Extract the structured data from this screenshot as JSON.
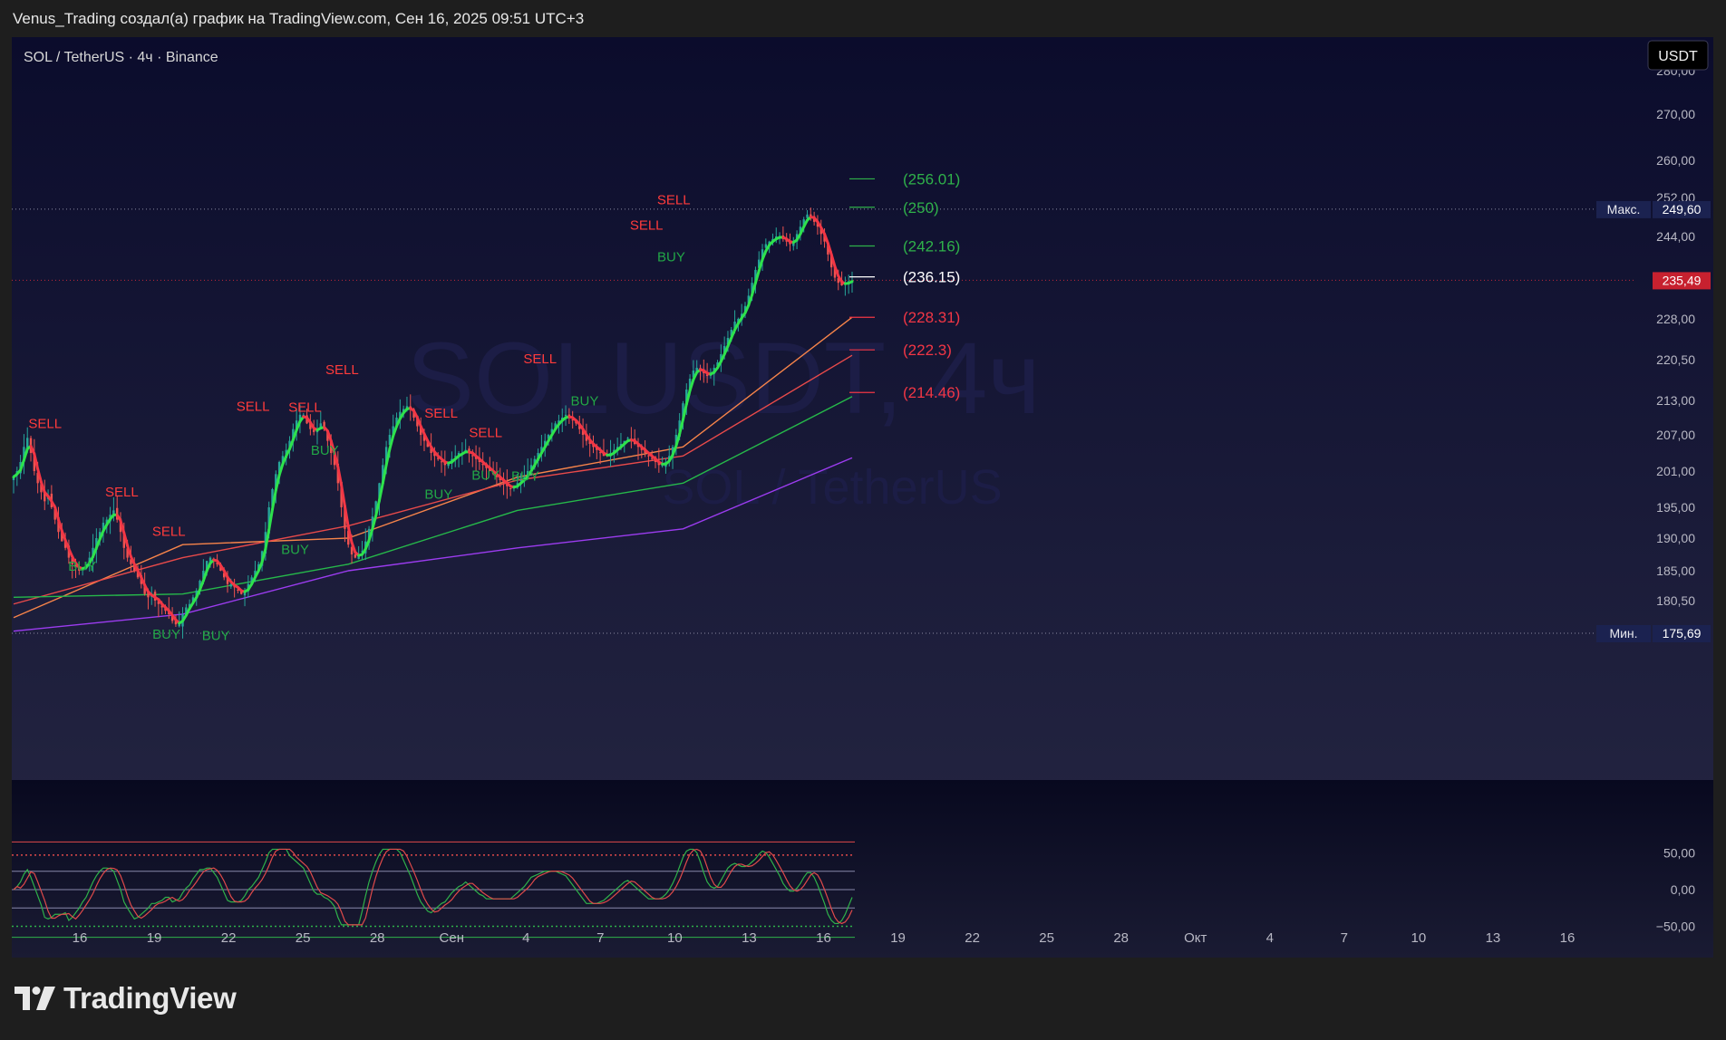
{
  "header": {
    "attribution": "Venus_Trading создал(а) график на TradingView.com, Сен 16, 2025 09:51 UTC+3"
  },
  "chart": {
    "symbol_line": "SOL / TetherUS · 4ч · Binance",
    "currency_button": "USDT",
    "watermark_big": "SOLUSDT, 4ч",
    "watermark_small": "SOL / TetherUS",
    "max_label": "Макс.",
    "max_value": "249,60",
    "min_label": "Мин.",
    "min_value": "175,69",
    "last_price": "235,49",
    "colors": {
      "bg_top": "#0b0c2c",
      "bg_bottom": "#272844",
      "bull": "#26a69a",
      "bear": "#ef5350",
      "trail_up": "#2ee24c",
      "trail_down": "#f23645",
      "ma_orange": "#f7844a",
      "ma_red": "#e84a4a",
      "ma_green": "#26b84a",
      "ma_purple": "#9c3cf0"
    }
  },
  "footer": {
    "brand": "TradingView"
  },
  "chart_data": {
    "type": "candlestick",
    "title": "SOLUSDT, 4ч",
    "y_ticks": [
      "280,00",
      "270,00",
      "260,00",
      "252,00",
      "244,00",
      "228,00",
      "220,50",
      "213,00",
      "207,00",
      "201,00",
      "195,00",
      "190,00",
      "185,00",
      "180,50"
    ],
    "x_ticks": [
      "16",
      "19",
      "22",
      "25",
      "28",
      "Сен",
      "4",
      "7",
      "10",
      "13",
      "16",
      "19",
      "22",
      "25",
      "28",
      "Окт",
      "4",
      "7",
      "10",
      "13",
      "16"
    ],
    "price_range": [
      175.69,
      249.6
    ],
    "levels": [
      {
        "label": "(256.01)",
        "value": 256.01,
        "color": "#2fb14a"
      },
      {
        "label": "(250)",
        "value": 250,
        "color": "#2fb14a"
      },
      {
        "label": "(242.16)",
        "value": 242.16,
        "color": "#2fb14a"
      },
      {
        "label": "(236.15)",
        "value": 236.15,
        "color": "#ffffff"
      },
      {
        "label": "(228.31)",
        "value": 228.31,
        "color": "#f23645"
      },
      {
        "label": "(222.3)",
        "value": 222.3,
        "color": "#f23645"
      },
      {
        "label": "(214.46)",
        "value": 214.46,
        "color": "#f23645"
      }
    ],
    "signals": [
      {
        "text": "SELL",
        "day": 0.8,
        "price": 208.2
      },
      {
        "text": "SELL",
        "day": 3.9,
        "price": 196.8
      },
      {
        "text": "SELL",
        "day": 5.8,
        "price": 190.4
      },
      {
        "text": "SELL",
        "day": 9.2,
        "price": 211.2
      },
      {
        "text": "SELL",
        "day": 11.3,
        "price": 211.0
      },
      {
        "text": "SELL",
        "day": 12.8,
        "price": 217.8
      },
      {
        "text": "SELL",
        "day": 16.8,
        "price": 210.0
      },
      {
        "text": "SELL",
        "day": 18.6,
        "price": 206.6
      },
      {
        "text": "SELL",
        "day": 20.8,
        "price": 219.8
      },
      {
        "text": "SELL",
        "day": 25.1,
        "price": 245.4
      },
      {
        "text": "SELL",
        "day": 26.2,
        "price": 250.6
      },
      {
        "text": "BUY",
        "day": 2.3,
        "price": 185.0
      },
      {
        "text": "BUY",
        "day": 5.7,
        "price": 174.9
      },
      {
        "text": "BUY",
        "day": 7.7,
        "price": 174.7
      },
      {
        "text": "BUY",
        "day": 10.9,
        "price": 187.6
      },
      {
        "text": "BUY",
        "day": 12.1,
        "price": 203.7
      },
      {
        "text": "BUY",
        "day": 16.7,
        "price": 196.4
      },
      {
        "text": "BUY",
        "day": 18.6,
        "price": 199.6
      },
      {
        "text": "BUY",
        "day": 20.2,
        "price": 199.4
      },
      {
        "text": "BUY",
        "day": 22.6,
        "price": 212.1
      },
      {
        "text": "BUY",
        "day": 26.1,
        "price": 239.2
      }
    ],
    "close_series": {
      "start": "Авг 13",
      "interval": "4ч",
      "values": [
        200.0,
        201.0,
        202.5,
        205.0,
        206.5,
        204.0,
        201.0,
        199.0,
        197.5,
        196.0,
        197.0,
        195.0,
        193.0,
        191.0,
        189.5,
        188.5,
        187.0,
        186.0,
        185.5,
        185.0,
        185.5,
        186.0,
        187.0,
        188.5,
        190.0,
        191.0,
        192.5,
        193.0,
        193.8,
        194.5,
        193.0,
        191.0,
        188.5,
        187.0,
        186.0,
        185.0,
        184.0,
        183.0,
        181.5,
        181.0,
        181.5,
        180.5,
        180.0,
        179.5,
        179.0,
        178.5,
        177.5,
        177.0,
        177.0,
        178.5,
        179.5,
        180.0,
        181.0,
        182.0,
        183.5,
        185.0,
        186.5,
        187.0,
        186.5,
        186.0,
        185.0,
        184.0,
        183.0,
        183.0,
        182.5,
        182.0,
        181.5,
        182.0,
        183.0,
        184.0,
        185.0,
        186.0,
        188.0,
        191.0,
        195.0,
        198.0,
        200.5,
        202.5,
        203.5,
        204.5,
        206.0,
        208.0,
        209.5,
        210.5,
        210.5,
        209.0,
        208.0,
        207.5,
        208.0,
        209.0,
        208.0,
        206.0,
        204.0,
        202.0,
        199.0,
        195.0,
        191.5,
        189.0,
        187.5,
        187.0,
        187.5,
        188.0,
        189.5,
        191.5,
        193.5,
        196.0,
        199.0,
        202.0,
        205.0,
        207.0,
        208.5,
        210.0,
        211.0,
        211.5,
        212.0,
        211.5,
        210.0,
        208.5,
        207.0,
        206.0,
        205.0,
        204.0,
        203.5,
        203.0,
        202.5,
        202.0,
        202.5,
        203.0,
        203.5,
        204.0,
        204.0,
        204.5,
        204.0,
        203.5,
        203.0,
        202.5,
        202.0,
        201.5,
        201.0,
        200.5,
        200.0,
        199.5,
        199.0,
        198.5,
        198.0,
        198.5,
        199.0,
        199.5,
        200.0,
        201.0,
        202.0,
        203.0,
        204.0,
        205.0,
        206.0,
        207.0,
        208.0,
        209.0,
        209.5,
        210.0,
        210.5,
        210.0,
        209.5,
        209.0,
        208.0,
        207.0,
        206.0,
        205.5,
        205.0,
        204.5,
        204.0,
        203.5,
        203.5,
        204.0,
        204.5,
        205.0,
        205.5,
        206.0,
        206.5,
        206.0,
        205.5,
        205.0,
        204.5,
        204.0,
        203.5,
        203.0,
        202.5,
        202.0,
        202.0,
        202.5,
        203.5,
        205.0,
        207.0,
        209.5,
        212.5,
        215.0,
        217.0,
        218.5,
        219.0,
        218.5,
        218.0,
        217.5,
        218.0,
        219.0,
        220.0,
        221.5,
        223.0,
        224.5,
        226.0,
        227.5,
        228.0,
        229.0,
        230.5,
        232.5,
        235.0,
        237.5,
        239.5,
        241.5,
        242.5,
        243.0,
        243.5,
        244.0,
        244.0,
        243.5,
        243.0,
        242.5,
        243.0,
        244.5,
        246.0,
        247.5,
        248.5,
        248.0,
        247.0,
        246.0,
        244.5,
        243.0,
        240.5,
        238.0,
        236.0,
        235.0,
        234.5,
        235.0,
        235.3,
        235.49
      ]
    },
    "moving_averages": [
      {
        "color": "orange",
        "values": [
          178.0,
          189.0,
          190.0,
          200.0,
          205.0,
          228.31
        ]
      },
      {
        "color": "red",
        "values": [
          180.0,
          187.0,
          192.0,
          199.5,
          203.5,
          221.3
        ]
      },
      {
        "color": "green",
        "values": [
          181.0,
          181.5,
          186.0,
          194.5,
          199.0,
          213.7
        ]
      },
      {
        "color": "purple",
        "values": [
          176.0,
          178.5,
          185.0,
          188.5,
          191.5,
          203.2
        ]
      }
    ],
    "oscillator": {
      "y_ticks": [
        "50,00",
        "0,00",
        "−50,00"
      ]
    }
  }
}
